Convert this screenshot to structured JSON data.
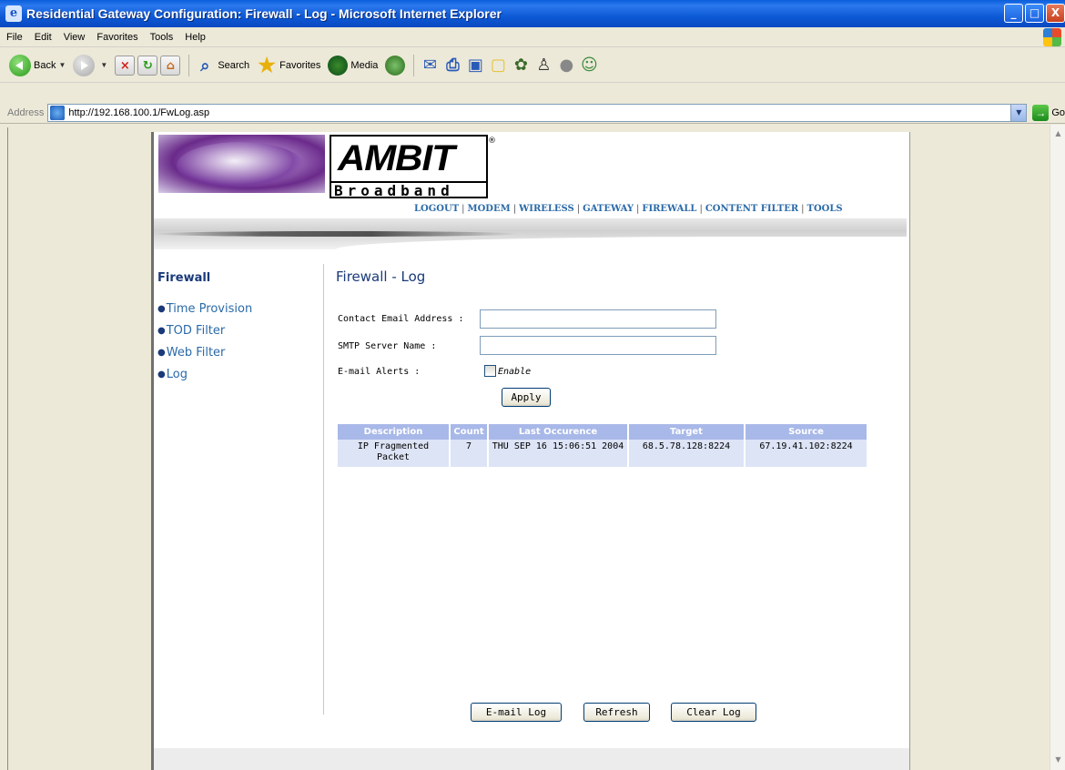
{
  "window": {
    "title": "Residential Gateway Configuration: Firewall - Log - Microsoft Internet Explorer",
    "controls": {
      "minimize": "_",
      "maximize": "□",
      "close": "X"
    }
  },
  "menu": {
    "items": [
      "File",
      "Edit",
      "View",
      "Favorites",
      "Tools",
      "Help"
    ]
  },
  "toolbar": {
    "back_label": "Back",
    "search_label": "Search",
    "favorites_label": "Favorites",
    "media_label": "Media"
  },
  "address": {
    "label": "Address",
    "url": "http://192.168.100.1/FwLog.asp",
    "go_label": "Go"
  },
  "header": {
    "logo_text": "AMBIT",
    "logo_sub": "Broadband",
    "reg_mark": "®",
    "nav": [
      "LOGOUT",
      "MODEM",
      "WIRELESS",
      "GATEWAY",
      "FIREWALL",
      "CONTENT FILTER",
      "TOOLS"
    ]
  },
  "sidebar": {
    "title": "Firewall",
    "items": [
      {
        "label": "Time Provision"
      },
      {
        "label": "TOD Filter"
      },
      {
        "label": "Web Filter"
      },
      {
        "label": "Log"
      }
    ]
  },
  "main": {
    "title": "Firewall - Log",
    "contact_email_label": "Contact Email Address :",
    "contact_email_value": "",
    "smtp_label": "SMTP Server Name :",
    "smtp_value": "",
    "alerts_label": "E-mail Alerts :",
    "enable_label": "Enable",
    "enable_checked": false,
    "apply_label": "Apply",
    "table": {
      "headers": [
        "Description",
        "Count",
        "Last Occurence",
        "Target",
        "Source"
      ],
      "rows": [
        {
          "description": "IP Fragmented Packet",
          "count": "7",
          "last_occurence": "THU SEP 16 15:06:51 2004",
          "target": "68.5.78.128:8224",
          "source": "67.19.41.102:8224"
        }
      ]
    },
    "email_log_label": "E-mail Log",
    "refresh_label": "Refresh",
    "clear_log_label": "Clear Log"
  },
  "colors": {
    "titlebar": "#0a5ddb",
    "nav_link": "#2a6aa8",
    "heading": "#1a3a7a",
    "table_header": "#a8b8e8",
    "table_cell": "#dde4f6"
  }
}
